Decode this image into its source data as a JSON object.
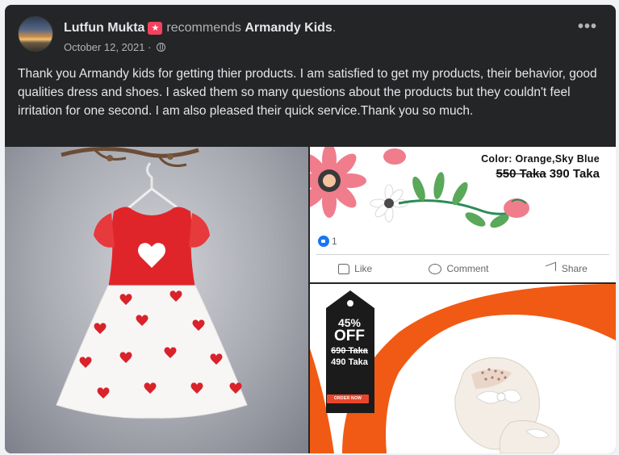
{
  "post": {
    "author": "Lutfun Mukta",
    "badge_icon": "top-fan-badge-icon",
    "verb": "recommends",
    "page_name": "Armandy Kids",
    "period": ".",
    "date": "October 12, 2021",
    "date_separator": " · ",
    "privacy_icon": "globe-icon",
    "more_label": "•••",
    "text": "Thank you Armandy kids for getting thier products. I am satisfied to get my products, their behavior, good qualities  dress and shoes. I asked them so many questions about the products but they couldn't feel irritation for one second. I am also pleased their quick service.Thank you so much."
  },
  "photos": {
    "right_top": {
      "color_text": "Color: Orange,Sky Blue",
      "price_old": "550 Taka",
      "price_new": "390 Taka",
      "reaction_count": "1",
      "like_label": "Like",
      "comment_label": "Comment",
      "share_label": "Share"
    },
    "right_bottom": {
      "discount_pct": "45%",
      "discount_off": "OFF",
      "price_old": "690 Taka",
      "price_new": "490 Taka",
      "order_label": "ORDER NOW"
    }
  },
  "colors": {
    "card_bg": "#242526",
    "primary_text": "#e4e6eb",
    "secondary_text": "#b0b3b8",
    "dress_red": "#e0252a",
    "accent_orange": "#f05a14"
  }
}
